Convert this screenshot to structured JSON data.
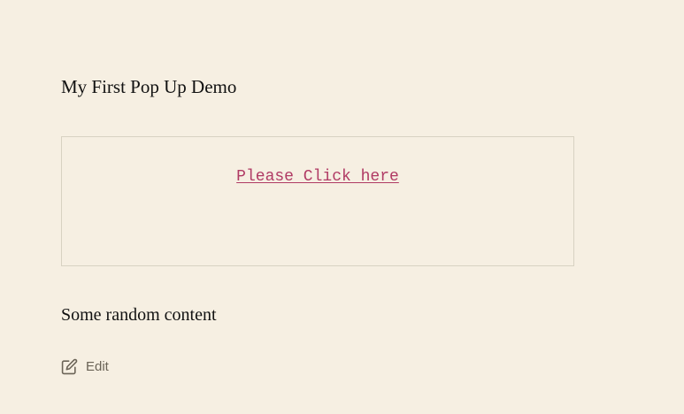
{
  "page": {
    "title": "My First Pop Up Demo",
    "content": "Some random content"
  },
  "popup": {
    "link_label": "Please Click here"
  },
  "edit": {
    "label": "Edit",
    "icon": "edit-icon"
  },
  "colors": {
    "background": "#f6efe2",
    "link": "#b03a64",
    "border": "#d8d2c2",
    "edit": "#6a6356"
  }
}
